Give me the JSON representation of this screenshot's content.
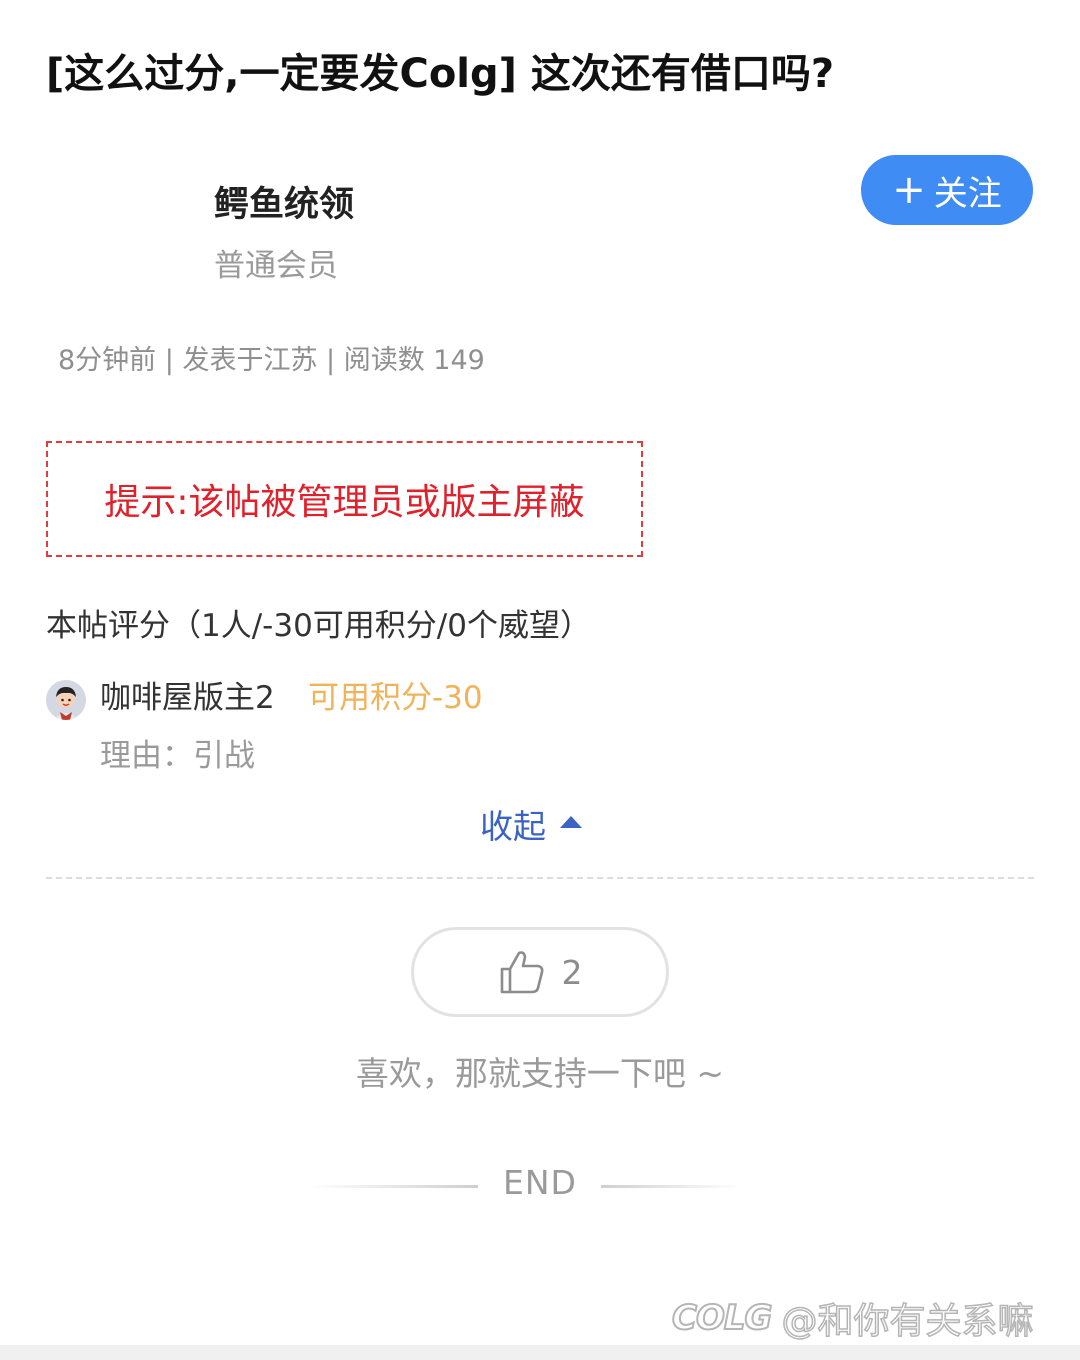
{
  "post": {
    "title": "[这么过分,一定要发Colg] 这次还有借口吗?"
  },
  "author": {
    "name": "鳄鱼统领",
    "rank": "普通会员",
    "follow_label": "关注"
  },
  "meta": {
    "text": "8分钟前 | 发表于江苏 | 阅读数 149"
  },
  "notice": {
    "text": "提示:该帖被管理员或版主屏蔽"
  },
  "rating": {
    "summary": "本帖评分（1人/-30可用积分/0个威望）",
    "rater_name": "咖啡屋版主2",
    "rater_points": "可用积分-30",
    "reason": "理由：引战",
    "collapse_label": "收起"
  },
  "like": {
    "count": "2",
    "hint": "喜欢，那就支持一下吧 ~"
  },
  "footer": {
    "end_label": "END"
  },
  "watermark": {
    "logo_text": "COLG",
    "handle": "@和你有关系嘛"
  },
  "colors": {
    "follow_button": "#3f8cf5",
    "notice_red": "#e0202a",
    "points_orange": "#f0b35a",
    "link_blue": "#3b63c4"
  }
}
